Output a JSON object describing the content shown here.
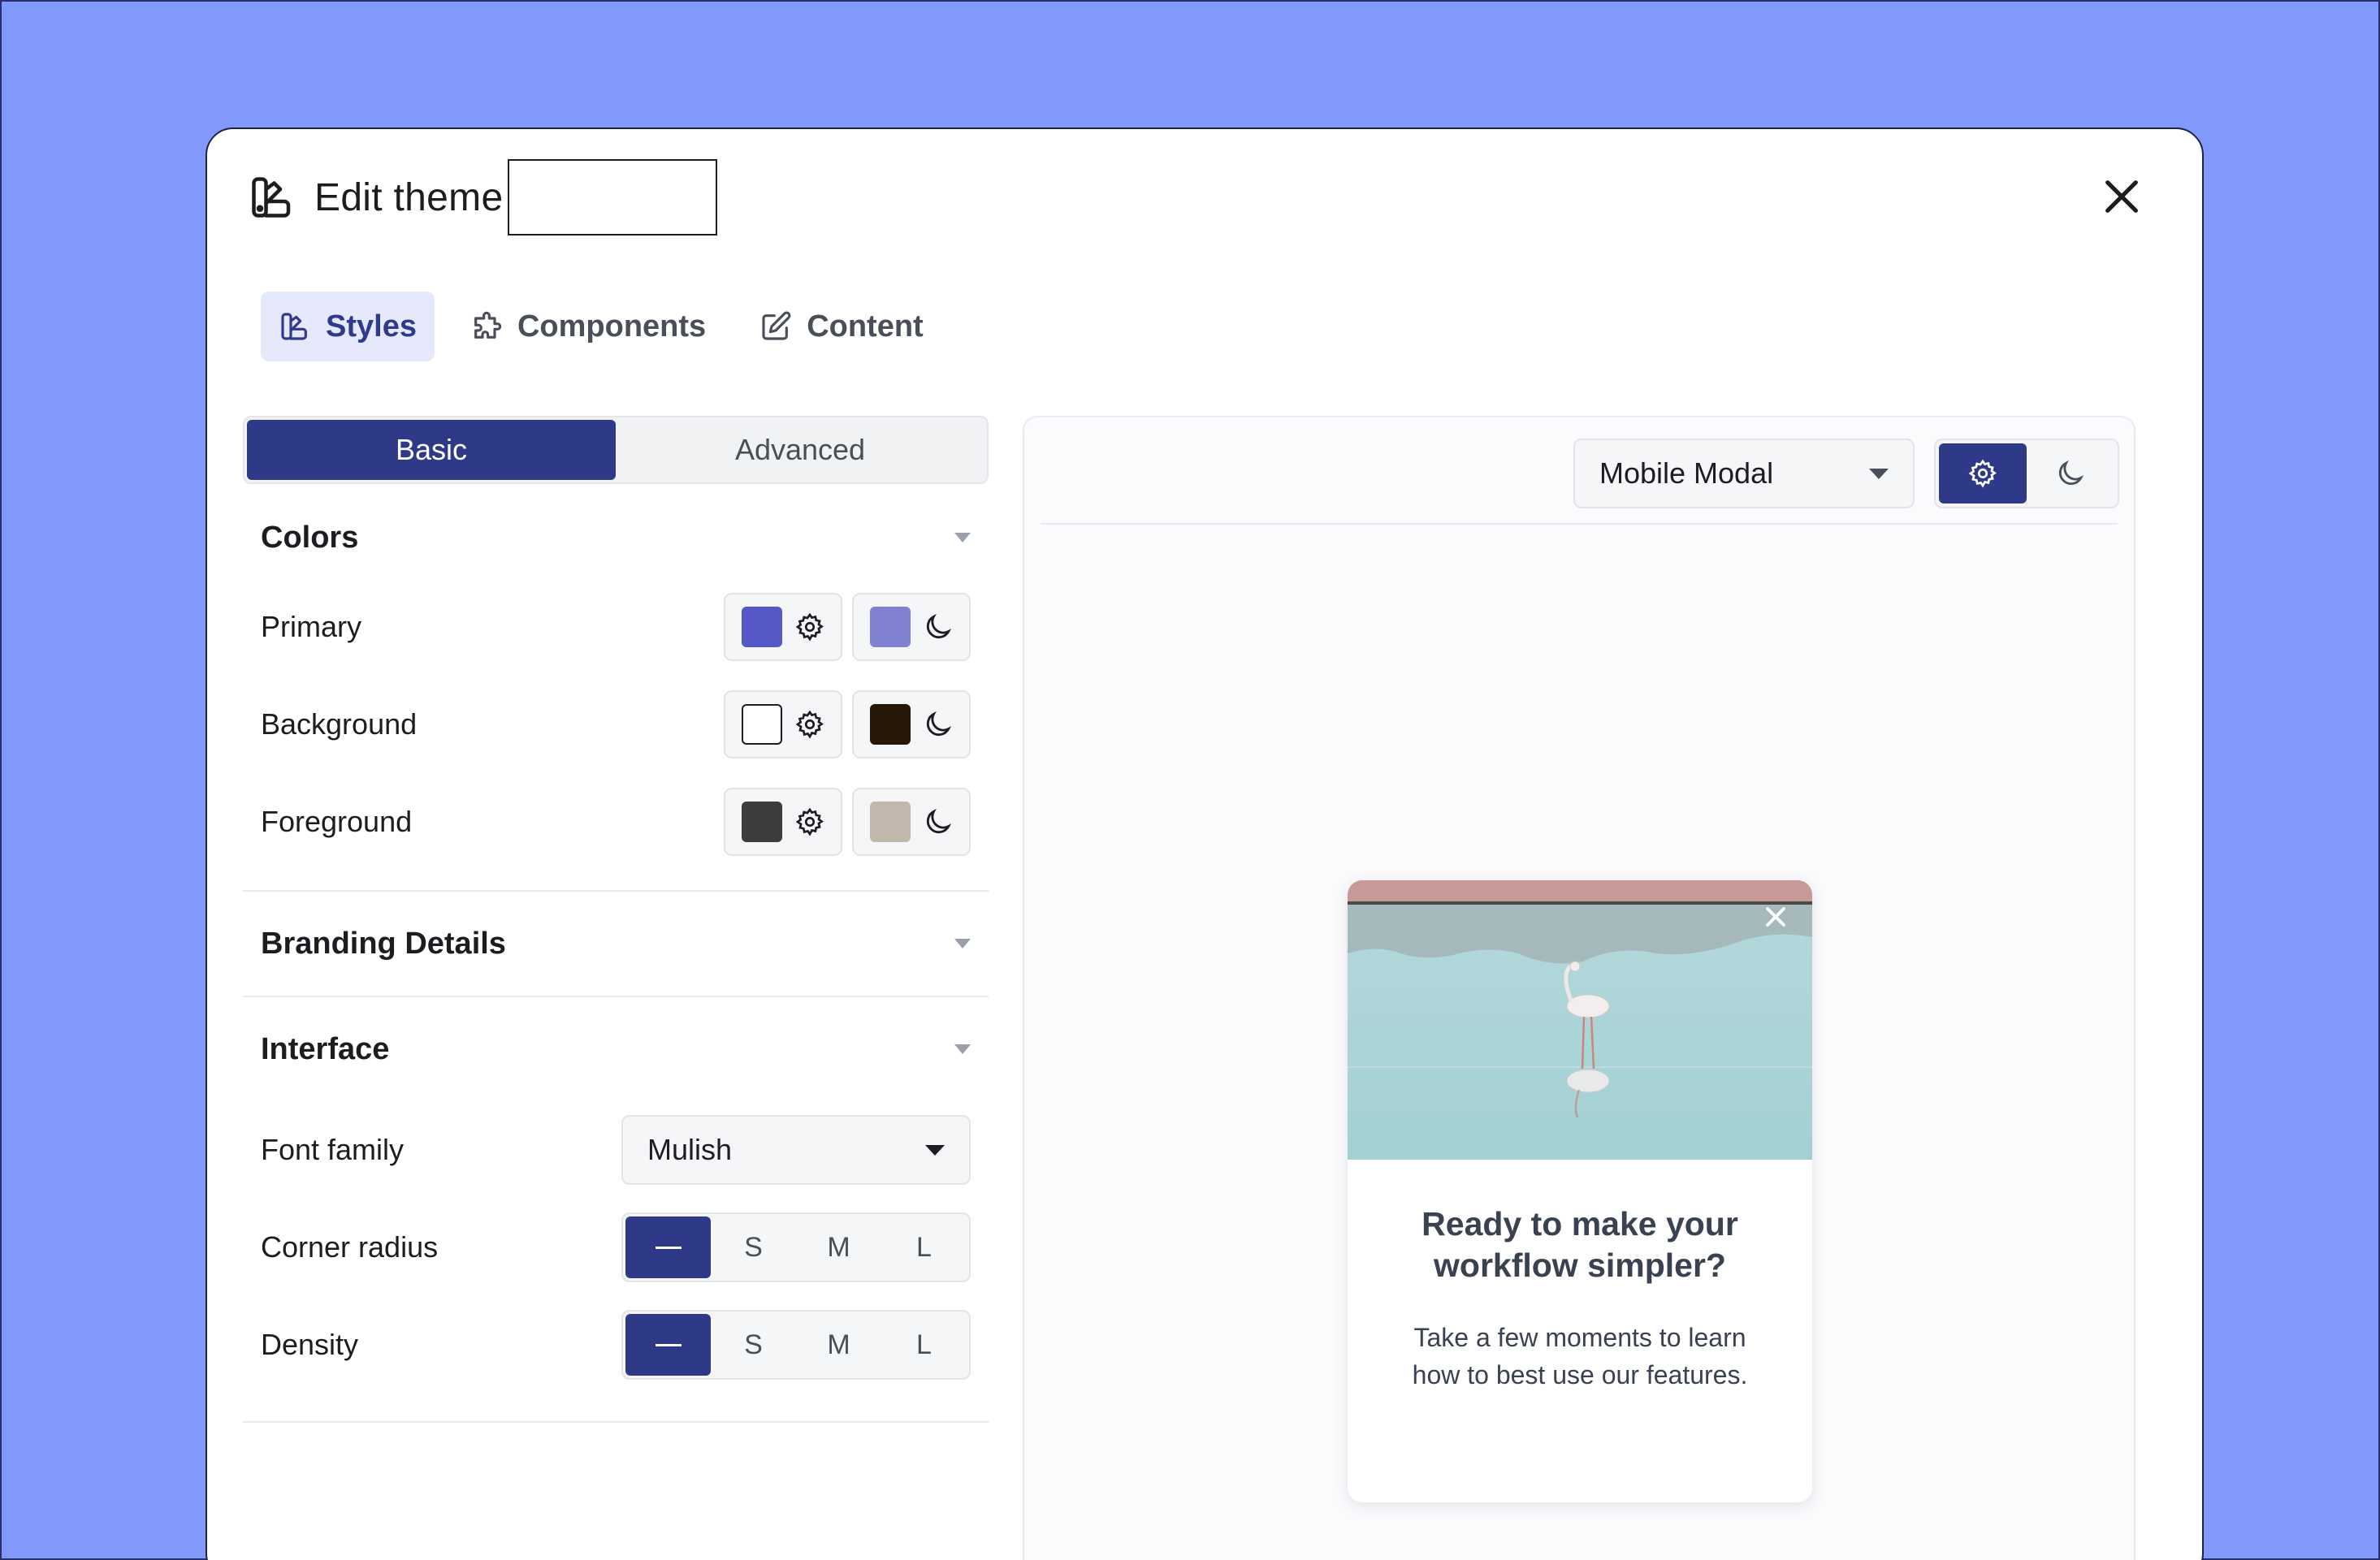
{
  "modal": {
    "title": "Edit theme",
    "title_input_value": ""
  },
  "tabs": [
    {
      "label": "Styles",
      "icon": "palette-icon",
      "active": true
    },
    {
      "label": "Components",
      "icon": "puzzle-icon",
      "active": false
    },
    {
      "label": "Content",
      "icon": "edit-icon",
      "active": false
    }
  ],
  "mode_segment": {
    "basic": "Basic",
    "advanced": "Advanced"
  },
  "colors": {
    "title": "Colors",
    "rows": [
      {
        "label": "Primary",
        "light": "#5658c8",
        "dark": "#8081d3"
      },
      {
        "label": "Background",
        "light": "#ffffff",
        "dark": "#261708"
      },
      {
        "label": "Foreground",
        "light": "#3d3d3d",
        "dark": "#c2b7ac"
      }
    ]
  },
  "branding": {
    "title": "Branding Details"
  },
  "interface": {
    "title": "Interface",
    "font_family_label": "Font family",
    "font_family_value": "Mulish",
    "corner_radius_label": "Corner radius",
    "density_label": "Density",
    "size_options": [
      "S",
      "M",
      "L"
    ]
  },
  "preview": {
    "select_value": "Mobile Modal",
    "card_heading": "Ready to make your workflow simpler?",
    "card_body": "Take a few moments to learn how to best use our features."
  }
}
